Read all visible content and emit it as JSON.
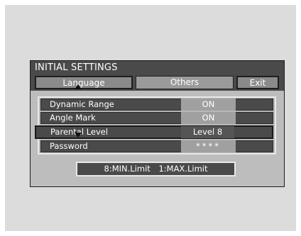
{
  "menu": {
    "title": "INITIAL SETTINGS",
    "tabs": [
      {
        "label": "Language"
      },
      {
        "label": "Others"
      },
      {
        "label": "Exit"
      }
    ],
    "rows": [
      {
        "label": "Dynamic Range",
        "value": "ON"
      },
      {
        "label": "Angle Mark",
        "value": "ON"
      },
      {
        "label": "Parental Level",
        "value": "Level 8"
      },
      {
        "label": "Password",
        "value": "****"
      }
    ],
    "hint": {
      "min": "8:MIN.Limit",
      "max": "1:MAX.Limit"
    }
  }
}
